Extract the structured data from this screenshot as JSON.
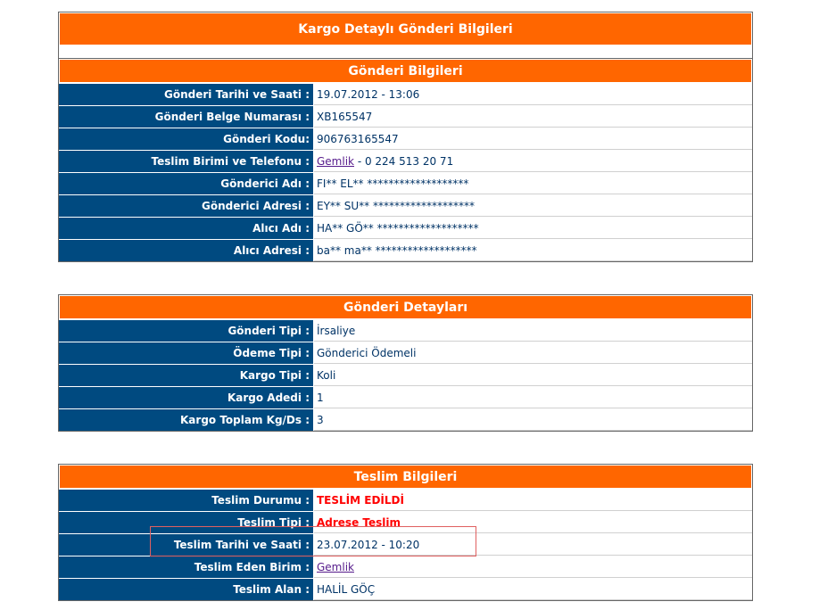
{
  "main_title": "Kargo Detaylı Gönderi Bilgileri",
  "section1": {
    "title": "Gönderi Bilgileri",
    "rows": [
      {
        "label": "Gönderi Tarihi ve Saati :",
        "value": "19.07.2012 - 13:06"
      },
      {
        "label": "Gönderi Belge Numarası :",
        "value": "XB165547"
      },
      {
        "label": "Gönderi Kodu:",
        "value": "906763165547"
      },
      {
        "label": "Teslim Birimi ve Telefonu :",
        "link": "Gemlik",
        "value": " - 0 224 513 20 71"
      },
      {
        "label": "Gönderici Adı :",
        "value": "FI** EL** *******************"
      },
      {
        "label": "Gönderici Adresi :",
        "value": "EY** SU** *******************"
      },
      {
        "label": "Alıcı Adı :",
        "value": "HA** GÖ** *******************"
      },
      {
        "label": "Alıcı Adresi :",
        "value": "ba** ma** *******************"
      }
    ]
  },
  "section2": {
    "title": "Gönderi Detayları",
    "rows": [
      {
        "label": "Gönderi Tipi :",
        "value": "İrsaliye"
      },
      {
        "label": "Ödeme Tipi :",
        "value": "Gönderici Ödemeli"
      },
      {
        "label": "Kargo Tipi :",
        "value": "Koli"
      },
      {
        "label": "Kargo Adedi :",
        "value": "1"
      },
      {
        "label": "Kargo Toplam Kg/Ds :",
        "value": "3"
      }
    ]
  },
  "section3": {
    "title": "Teslim Bilgileri",
    "rows": [
      {
        "label": "Teslim Durumu :",
        "value": "TESLİM EDİLDİ"
      },
      {
        "label": "Teslim Tipi :",
        "value": "Adrese Teslim"
      },
      {
        "label": "Teslim Tarihi ve Saati :",
        "value": "23.07.2012 - 10:20"
      },
      {
        "label": "Teslim Eden Birim :",
        "link": "Gemlik"
      },
      {
        "label": "Teslim Alan :",
        "value": "HALİL GÖÇ"
      }
    ]
  },
  "colors": {
    "header_orange": "#ff6600",
    "label_blue": "#004a80",
    "value_text": "#003366",
    "status_red": "#ff0000",
    "highlight_border": "#e06060"
  }
}
